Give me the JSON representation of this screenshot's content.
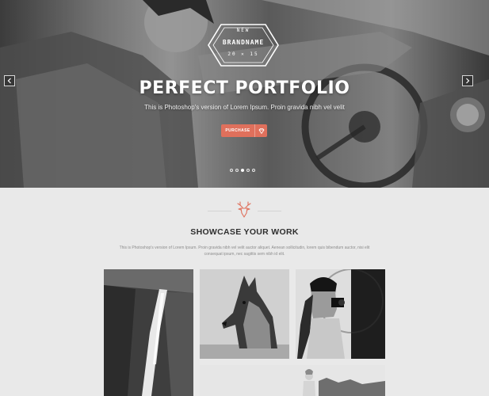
{
  "hero": {
    "brand": {
      "top": "NEW",
      "name": "BRANDNAME",
      "year": "20 ✕ 15"
    },
    "title": "PERFECT PORTFOLIO",
    "subtitle": "This is Photoshop's version  of Lorem Ipsum. Proin gravida nibh vel velit",
    "purchase_label": "PURCHASE",
    "slides": [
      {
        "active": false
      },
      {
        "active": false
      },
      {
        "active": true
      },
      {
        "active": false
      },
      {
        "active": false
      }
    ]
  },
  "showcase": {
    "title": "SHOWCASE YOUR WORK",
    "description": "This is Photoshop's version  of Lorem Ipsum. Proin gravida nibh vel velit auctor aliquet. Aenean sollicitudin, lorem quis bibendum auctor, nisi elit consequat ipsum, nec sagittis sem nibh id elit."
  },
  "colors": {
    "accent": "#e0705c",
    "background": "#e9e9e9",
    "title": "#2f2f2f",
    "muted": "#8c8c8c"
  },
  "icons": {
    "prev": "chevron-left-icon",
    "next": "chevron-right-icon",
    "gem": "diamond-icon",
    "logo": "deer-head-icon"
  }
}
